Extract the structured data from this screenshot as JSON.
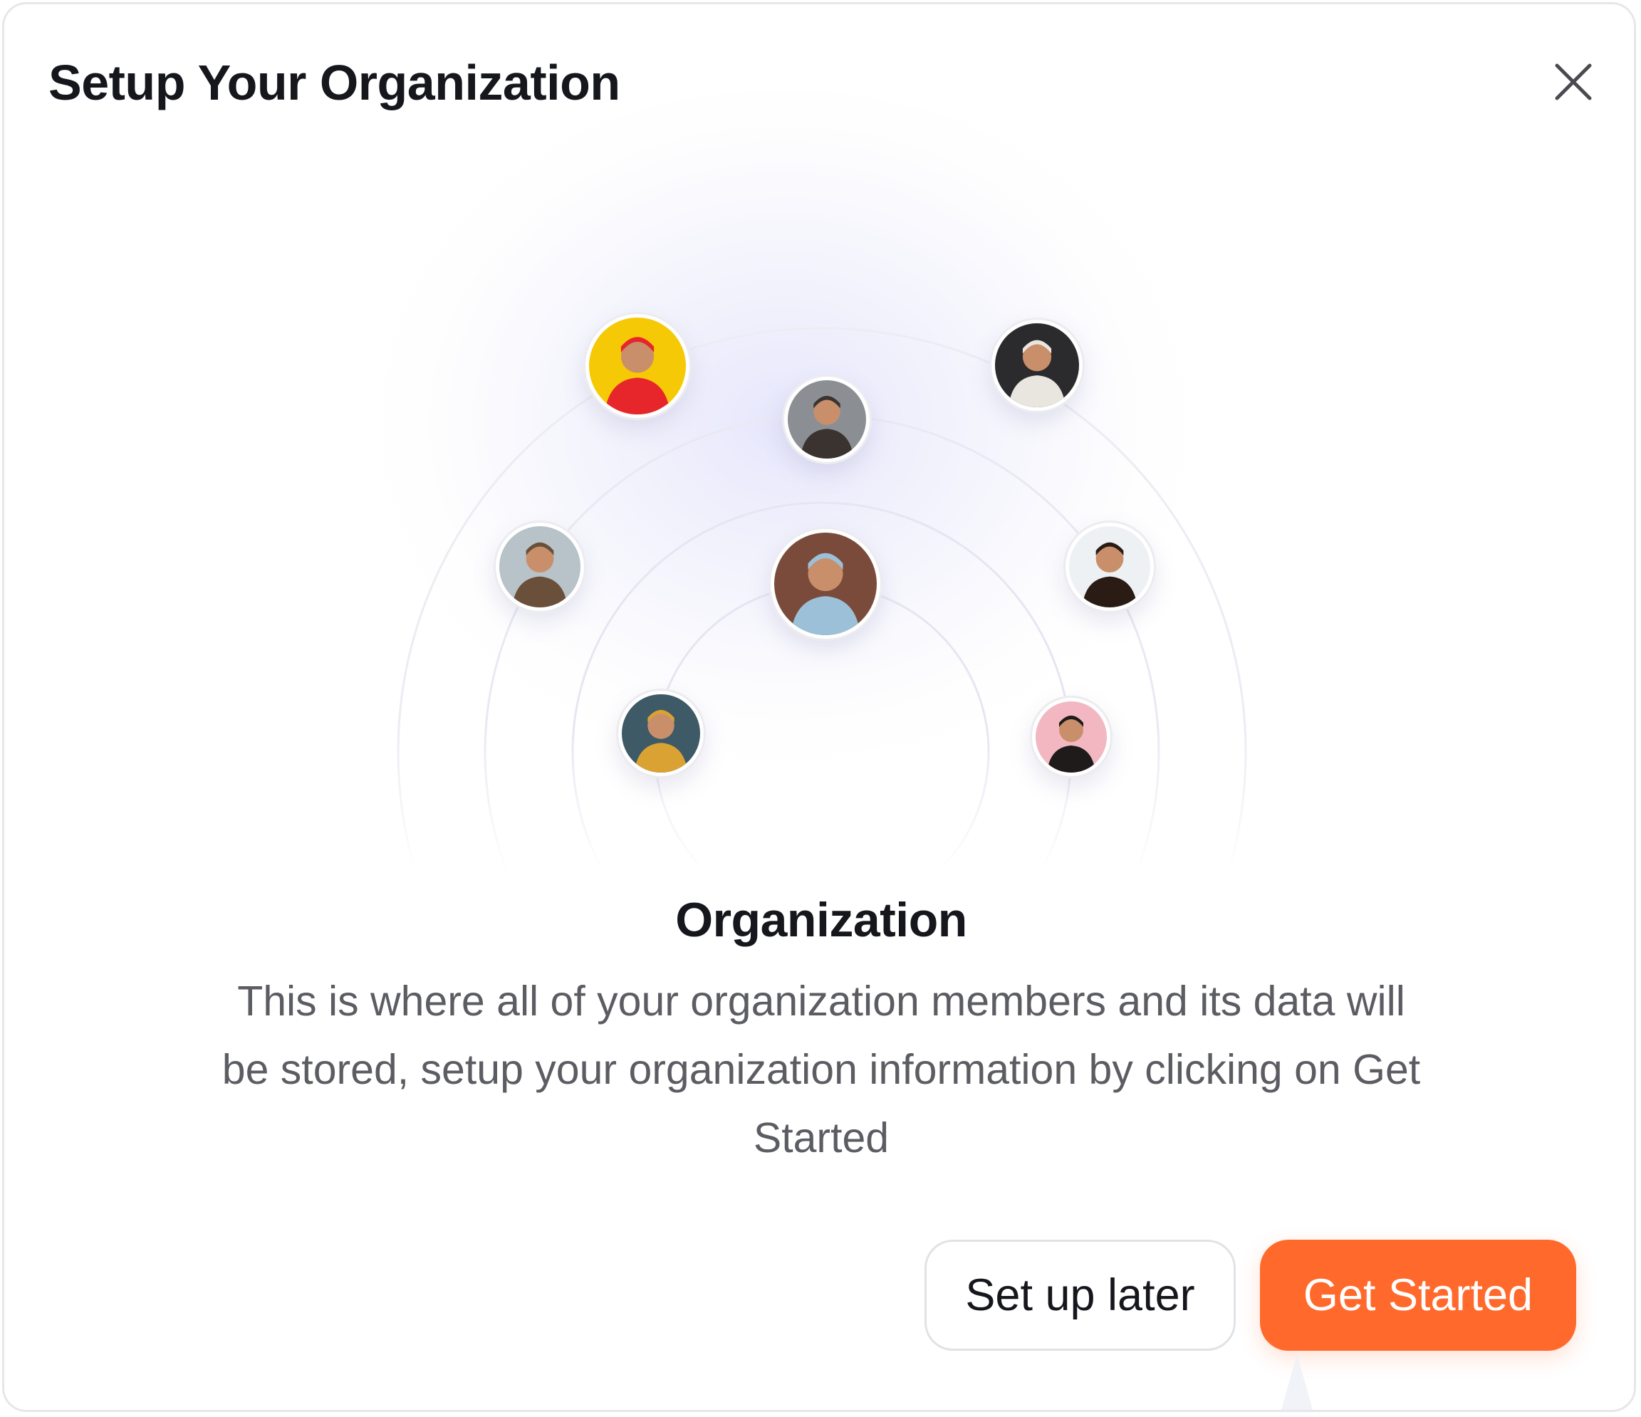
{
  "dialog": {
    "title": "Setup Your Organization",
    "close_icon": "close-icon"
  },
  "illustration": {
    "avatars": [
      {
        "name": "member-avatar-1",
        "bg": "#f6c906",
        "accent": "#e7262c"
      },
      {
        "name": "member-avatar-2",
        "bg": "#8b8f94",
        "accent": "#3b3330"
      },
      {
        "name": "member-avatar-3",
        "bg": "#2b2b2e",
        "accent": "#e9e6e0"
      },
      {
        "name": "member-avatar-4",
        "bg": "#b8c2c9",
        "accent": "#6a4f3a"
      },
      {
        "name": "member-avatar-5",
        "bg": "#7a4b3a",
        "accent": "#9cc0d8"
      },
      {
        "name": "member-avatar-6",
        "bg": "#eef1f4",
        "accent": "#2a1c15"
      },
      {
        "name": "member-avatar-7",
        "bg": "#3d5a66",
        "accent": "#d9a233"
      },
      {
        "name": "member-avatar-8",
        "bg": "#f2b7c1",
        "accent": "#1f1b1b"
      }
    ]
  },
  "content": {
    "heading": "Organization",
    "description": "This is where all of your organization members and its data will be stored, setup your organization information by clicking on Get Started"
  },
  "actions": {
    "secondary_label": "Set up later",
    "primary_label": "Get Started"
  },
  "colors": {
    "primary": "#ff6a2c",
    "text": "#15171c",
    "muted_text": "#5c5d63",
    "border": "#e2e2e6"
  }
}
